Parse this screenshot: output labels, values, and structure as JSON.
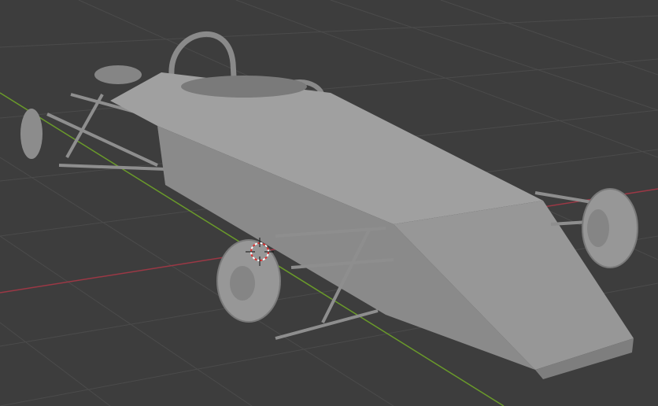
{
  "viewport": {
    "background": "#3d3d3d",
    "grid_color": "#4a4a4a",
    "x_axis_color": "#9b3845",
    "y_axis_color": "#6a9a2a",
    "model_color": "#9c9c9c"
  },
  "cursor": {
    "primary": "#e03030",
    "secondary": "#ffffff"
  }
}
